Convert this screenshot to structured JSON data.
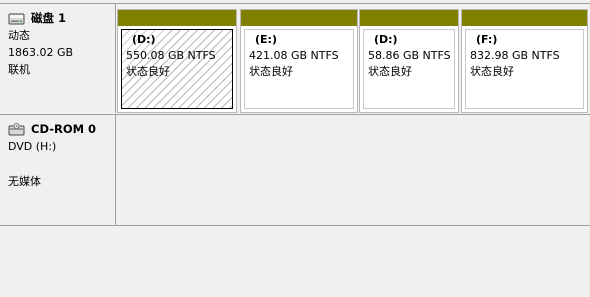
{
  "disks": [
    {
      "name": "磁盘 1",
      "icon": "hard-disk-icon",
      "type": "动态",
      "size": "1863.02 GB",
      "status": "联机",
      "partitions": [
        {
          "label": "(D:)",
          "size_fs": "550.08 GB NTFS",
          "health": "状态良好",
          "selected": true
        },
        {
          "label": "(E:)",
          "size_fs": "421.08 GB NTFS",
          "health": "状态良好",
          "selected": false
        },
        {
          "label": "(D:)",
          "size_fs": "58.86 GB NTFS",
          "health": "状态良好",
          "selected": false
        },
        {
          "label": "(F:)",
          "size_fs": "832.98 GB NTFS",
          "health": "状态良好",
          "selected": false
        }
      ]
    },
    {
      "name": "CD-ROM 0",
      "icon": "cd-rom-icon",
      "type": "DVD (H:)",
      "status": "无媒体"
    }
  ],
  "colors": {
    "volume_bar": "#808000",
    "border": "#a0a0a0",
    "background": "#f0f0f0"
  }
}
